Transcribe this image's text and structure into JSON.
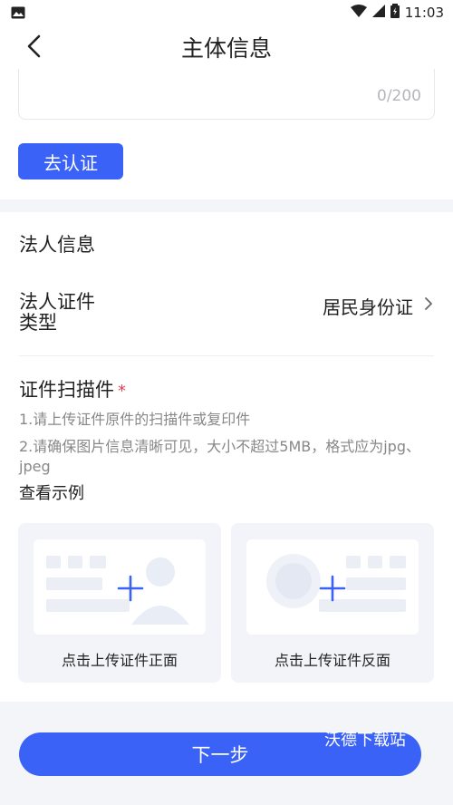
{
  "status_bar": {
    "time": "11:03"
  },
  "header": {
    "title": "主体信息"
  },
  "description": {
    "counter": "0/200"
  },
  "verify_button": "去认证",
  "legal_section": {
    "title": "法人信息",
    "id_type_label": "法人证件类型",
    "id_type_value": "居民身份证",
    "scan_title": "证件扫描件",
    "required_mark": "*",
    "note1": "1.请上传证件原件的扫描件或复印件",
    "note2": "2.请确保图片信息清晰可见，大小不超过5MB，格式应为jpg、jpeg",
    "example_link": "查看示例",
    "upload_front_label": "点击上传证件正面",
    "upload_back_label": "点击上传证件反面"
  },
  "next_button": "下一步",
  "watermark": "沃德下载站",
  "colors": {
    "accent": "#3b62f6",
    "required": "#e83e5a"
  }
}
